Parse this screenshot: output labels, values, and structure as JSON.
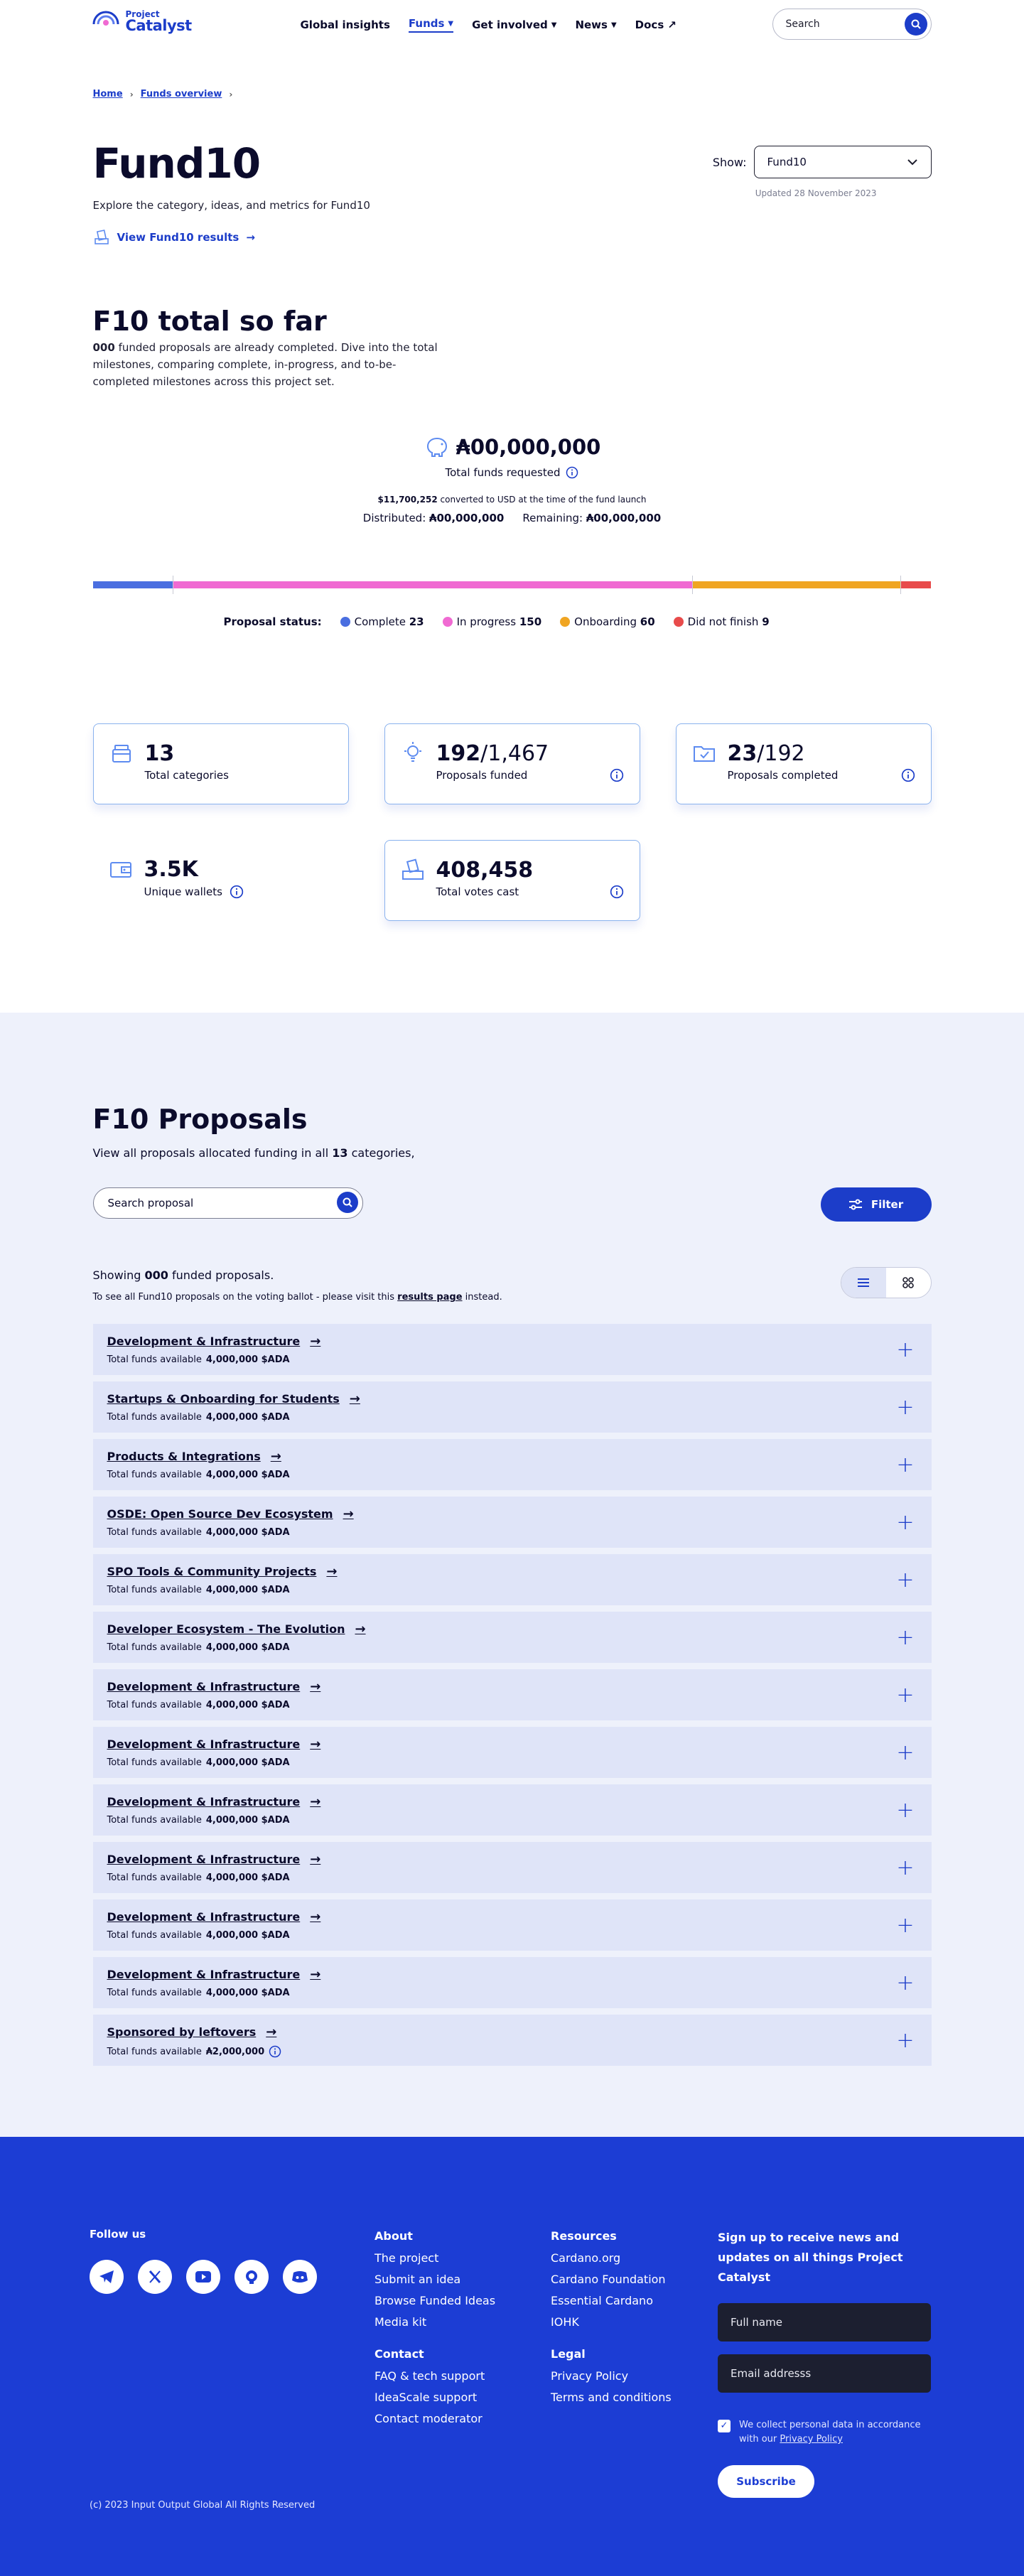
{
  "header": {
    "logo_small": "Project",
    "logo_big": "Catalyst",
    "nav": [
      "Global insights",
      "Funds",
      "Get involved",
      "News",
      "Docs"
    ],
    "search_placeholder": "Search"
  },
  "breadcrumb": [
    "Home",
    "Funds overview"
  ],
  "fund": {
    "title": "Fund10",
    "subtitle": "Explore the category, ideas, and metrics for Fund10",
    "results_link": "View Fund10 results",
    "show_label": "Show:",
    "selected_fund": "Fund10",
    "updated": "Updated 28 November 2023"
  },
  "total": {
    "title": "F10 total so far",
    "count": "000",
    "desc": " funded proposals are already completed. Dive into the total milestones, comparing complete, in-progress, and to-be-completed milestones across this project set.",
    "amount": "₳00,000,000",
    "amount_label": "Total funds requested",
    "usd_value": "$11,700,252",
    "usd_text": " converted to USD at the time of the fund launch",
    "distributed_label": "Distributed:",
    "distributed": "₳00,000,000",
    "remaining_label": "Remaining:",
    "remaining": "₳00,000,000"
  },
  "proposal_status": {
    "label": "Proposal status:",
    "items": [
      {
        "name": "Complete",
        "count": 23,
        "color": "#4a6ee0"
      },
      {
        "name": "In progress",
        "count": 150,
        "color": "#f06ad2"
      },
      {
        "name": "Onboarding",
        "count": 60,
        "color": "#f0a522"
      },
      {
        "name": "Did not finish",
        "count": 9,
        "color": "#e84b4b"
      }
    ]
  },
  "stats": {
    "categories": {
      "value": "13",
      "label": "Total categories"
    },
    "funded": {
      "value": "192",
      "rest": "/1,467",
      "label": "Proposals funded"
    },
    "completed": {
      "value": "23",
      "rest": "/192",
      "label": "Proposals completed"
    },
    "wallets": {
      "value": "3.5K",
      "label": "Unique wallets"
    },
    "votes": {
      "value": "408,458",
      "label": "Total votes cast"
    }
  },
  "proposals": {
    "title": "F10 Proposals",
    "desc_pre": "View all proposals allocated funding in all ",
    "desc_count": "13",
    "desc_post": " categories,",
    "search_placeholder": "Search proposal",
    "filter_label": "Filter",
    "showing_pre": "Showing ",
    "showing_count": "000",
    "showing_post": " funded proposals.",
    "ballot_pre": "To see all Fund10 proposals on the voting ballot - please visit this ",
    "ballot_link": "results page",
    "ballot_post": " instead.",
    "funds_label": "Total funds available",
    "categories": [
      {
        "name": "Development & Infrastructure",
        "amount": "4,000,000 $ADA"
      },
      {
        "name": "Startups & Onboarding for Students",
        "amount": "4,000,000 $ADA"
      },
      {
        "name": "Products & Integrations",
        "amount": "4,000,000 $ADA"
      },
      {
        "name": "OSDE: Open Source Dev Ecosystem",
        "amount": "4,000,000 $ADA"
      },
      {
        "name": "SPO Tools & Community Projects",
        "amount": "4,000,000 $ADA"
      },
      {
        "name": "Developer Ecosystem - The Evolution",
        "amount": "4,000,000 $ADA"
      },
      {
        "name": "Development & Infrastructure",
        "amount": "4,000,000 $ADA"
      },
      {
        "name": "Development & Infrastructure",
        "amount": "4,000,000 $ADA"
      },
      {
        "name": "Development & Infrastructure",
        "amount": "4,000,000 $ADA"
      },
      {
        "name": "Development & Infrastructure",
        "amount": "4,000,000 $ADA"
      },
      {
        "name": "Development & Infrastructure",
        "amount": "4,000,000 $ADA"
      },
      {
        "name": "Development & Infrastructure",
        "amount": "4,000,000 $ADA"
      },
      {
        "name": "Sponsored by leftovers",
        "amount": "₳2,000,000"
      }
    ]
  },
  "footer": {
    "follow": "Follow us",
    "about": {
      "title": "About",
      "items": [
        "The project",
        "Submit an idea",
        "Browse Funded Ideas",
        "Media kit"
      ]
    },
    "contact": {
      "title": "Contact",
      "items": [
        "FAQ & tech support",
        "IdeaScale support",
        "Contact moderator"
      ]
    },
    "resources": {
      "title": "Resources",
      "items": [
        "Cardano.org",
        "Cardano Foundation",
        "Essential Cardano",
        "IOHK"
      ]
    },
    "legal": {
      "title": "Legal",
      "items": [
        "Privacy Policy",
        "Terms and conditions"
      ]
    },
    "newsletter_title": "Sign up to receive news and updates on all things Project Catalyst",
    "fullname_placeholder": "Full name",
    "email_placeholder": "Email addresss",
    "consent_pre": "We collect personal data in accordance with our ",
    "consent_link": "Privacy Policy",
    "subscribe": "Subscribe",
    "copyright": "(c) 2023 Input Output Global All Rights Reserved"
  }
}
